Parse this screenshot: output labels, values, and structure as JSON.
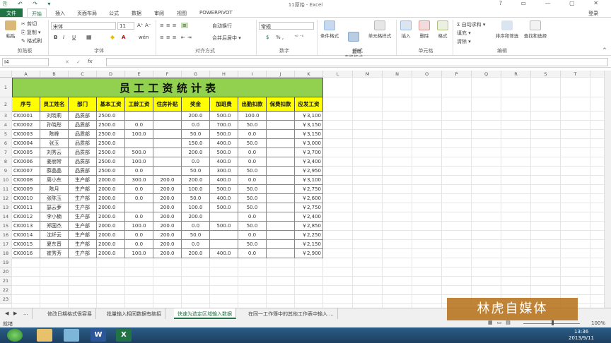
{
  "window": {
    "title": "11原始 - Excel",
    "quick_access": "⎘ ↶ ↷ ▾",
    "controls": "? ▭ — ▢ ✕"
  },
  "tabs": [
    "文件",
    "开始",
    "插入",
    "页面布局",
    "公式",
    "数据",
    "审阅",
    "视图",
    "POWERPIVOT"
  ],
  "login": "登录",
  "ribbon": {
    "clipboard": {
      "paste": "粘贴",
      "cut": "✂ 剪切",
      "copy": "⎘ 复制 ▾",
      "format_painter": "✎ 格式刷",
      "label": "剪贴板"
    },
    "font": {
      "name": "宋体",
      "size": "11",
      "bold": "B",
      "italic": "I",
      "underline": "U",
      "grow": "A⁺",
      "shrink": "A⁻",
      "phonetic": "wén",
      "label": "字体"
    },
    "alignment": {
      "wrap": "自动换行",
      "merge": "合并后居中 ▾",
      "label": "对齐方式"
    },
    "number": {
      "format": "常规",
      "pct": "% ,",
      "label": "数字"
    },
    "styles": {
      "cond": "条件格式",
      "table": "套用\n表格格式",
      "cell": "单元格样式",
      "label": "样式"
    },
    "cells": {
      "insert": "插入",
      "delete": "删除",
      "format": "格式",
      "label": "单元格"
    },
    "editing": {
      "autosum": "Σ 自动求和 ▾",
      "fill": "填充 ▾",
      "clear": "清除 ▾",
      "sort": "排序和筛选",
      "find": "查找和选择",
      "label": "编辑"
    }
  },
  "formula_bar": {
    "name_box": "I4",
    "fx": "fx",
    "cancel": "✕",
    "enter": "✓",
    "value": ""
  },
  "columns": [
    "A",
    "B",
    "C",
    "D",
    "E",
    "F",
    "G",
    "H",
    "I",
    "J",
    "K",
    "L",
    "M",
    "N",
    "O",
    "P",
    "Q",
    "R",
    "S",
    "T"
  ],
  "rows": [
    "1",
    "2",
    "3",
    "4",
    "5",
    "6",
    "7",
    "8",
    "9",
    "10",
    "11",
    "12",
    "13",
    "14",
    "15",
    "16",
    "17",
    "18",
    "19",
    "20",
    "21",
    "22",
    "23"
  ],
  "sheet": {
    "title": "员 工 工 资 统 计 表",
    "headers": [
      "序号",
      "员工姓名",
      "部门",
      "基本工资",
      "工龄工资",
      "住房补贴",
      "奖金",
      "加班费",
      "出勤扣款",
      "保费扣款",
      "应发工资"
    ],
    "data": [
      [
        "CK0001",
        "刘晓莉",
        "品质部",
        "2500.0",
        "",
        "",
        "200.0",
        "500.0",
        "100.0",
        "",
        "￥3,100"
      ],
      [
        "CK0002",
        "孙晓彤",
        "品质部",
        "2500.0",
        "0.0",
        "",
        "0.0",
        "700.0",
        "50.0",
        "",
        "￥3,150"
      ],
      [
        "CK0003",
        "陈峰",
        "品质部",
        "2500.0",
        "100.0",
        "",
        "50.0",
        "500.0",
        "0.0",
        "",
        "￥3,150"
      ],
      [
        "CK0004",
        "张玉",
        "品质部",
        "2500.0",
        "",
        "",
        "150.0",
        "400.0",
        "50.0",
        "",
        "￥3,000"
      ],
      [
        "CK0005",
        "刘秀云",
        "品质部",
        "2500.0",
        "500.0",
        "",
        "200.0",
        "500.0",
        "0.0",
        "",
        "￥3,700"
      ],
      [
        "CK0006",
        "姜丽常",
        "品质部",
        "2500.0",
        "100.0",
        "",
        "0.0",
        "400.0",
        "0.0",
        "",
        "￥3,400"
      ],
      [
        "CK0007",
        "薛晶晶",
        "品质部",
        "2500.0",
        "0.0",
        "",
        "50.0",
        "300.0",
        "50.0",
        "",
        "￥2,950"
      ],
      [
        "CK0008",
        "周小东",
        "生产部",
        "2000.0",
        "300.0",
        "200.0",
        "200.0",
        "400.0",
        "0.0",
        "",
        "￥3,100"
      ],
      [
        "CK0009",
        "陈月",
        "生产部",
        "2000.0",
        "0.0",
        "200.0",
        "100.0",
        "500.0",
        "50.0",
        "",
        "￥2,750"
      ],
      [
        "CK0010",
        "张陈玉",
        "生产部",
        "2000.0",
        "0.0",
        "200.0",
        "50.0",
        "400.0",
        "50.0",
        "",
        "￥2,600"
      ],
      [
        "CK0011",
        "瑟云萝",
        "生产部",
        "2000.0",
        "",
        "200.0",
        "100.0",
        "500.0",
        "50.0",
        "",
        "￥2,750"
      ],
      [
        "CK0012",
        "李小楠",
        "生产部",
        "2000.0",
        "0.0",
        "200.0",
        "200.0",
        "",
        "0.0",
        "",
        "￥2,400"
      ],
      [
        "CK0013",
        "郑国杰",
        "生产部",
        "2000.0",
        "100.0",
        "200.0",
        "0.0",
        "500.0",
        "50.0",
        "",
        "￥2,850"
      ],
      [
        "CK0014",
        "沈纤云",
        "生产部",
        "2000.0",
        "0.0",
        "200.0",
        "50.0",
        "",
        "0.0",
        "",
        "￥2,250"
      ],
      [
        "CK0015",
        "夏东晋",
        "生产部",
        "2000.0",
        "0.0",
        "200.0",
        "0.0",
        "",
        "50.0",
        "",
        "￥2,150"
      ],
      [
        "CK0016",
        "崔秀芳",
        "生产部",
        "2000.0",
        "100.0",
        "200.0",
        "200.0",
        "400.0",
        "0.0",
        "",
        "￥2,900"
      ]
    ]
  },
  "sheet_tabs": [
    "...",
    "修改日期格式很容易",
    "批量输入相同数据有绝招",
    "快速为选定区域输入数据",
    "在同一工作簿中的其他工作表中输入 ..."
  ],
  "status": {
    "ready": "就绪",
    "zoom": "100%"
  },
  "watermark": "林虎自媒体",
  "clock": {
    "time": "13:36",
    "date": "2013/9/11"
  },
  "colors": {
    "title_fill": "#92d050",
    "header_fill": "#ffff00",
    "accent": "#217346"
  }
}
